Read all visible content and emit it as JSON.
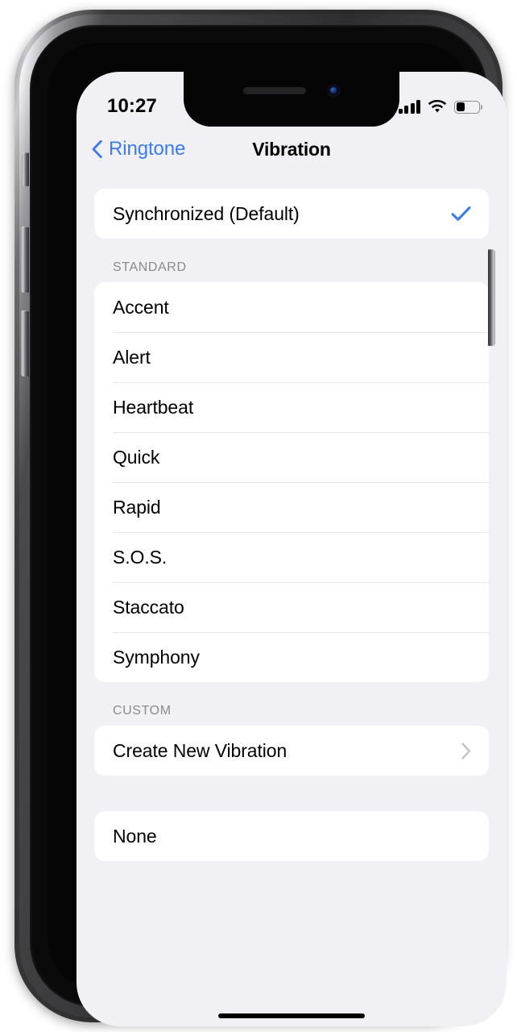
{
  "device": {
    "name": "iphone-x",
    "frame_color": "#2a2a2c"
  },
  "status_bar": {
    "time": "10:27",
    "signal_icon": "cellular-signal-icon",
    "signal_bars_total": 4,
    "signal_bars_active": 4,
    "wifi_icon": "wifi-icon",
    "wifi_strength": "full",
    "battery_icon": "battery-icon",
    "battery_percent": 40
  },
  "nav_bar": {
    "back_icon": "chevron-left-icon",
    "back_label": "Ringtone",
    "title": "Vibration",
    "accent_color": "#3b7ded"
  },
  "sections": [
    {
      "key": "default",
      "header": "",
      "rows": [
        {
          "label": "Synchronized (Default)",
          "accessory": "checkmark",
          "selected": true
        }
      ]
    },
    {
      "key": "standard",
      "header": "STANDARD",
      "rows": [
        {
          "label": "Accent",
          "accessory": "none",
          "selected": false
        },
        {
          "label": "Alert",
          "accessory": "none",
          "selected": false
        },
        {
          "label": "Heartbeat",
          "accessory": "none",
          "selected": false
        },
        {
          "label": "Quick",
          "accessory": "none",
          "selected": false
        },
        {
          "label": "Rapid",
          "accessory": "none",
          "selected": false
        },
        {
          "label": "S.O.S.",
          "accessory": "none",
          "selected": false
        },
        {
          "label": "Staccato",
          "accessory": "none",
          "selected": false
        },
        {
          "label": "Symphony",
          "accessory": "none",
          "selected": false
        }
      ]
    },
    {
      "key": "custom",
      "header": "CUSTOM",
      "rows": [
        {
          "label": "Create New Vibration",
          "accessory": "disclosure",
          "selected": false
        }
      ]
    },
    {
      "key": "none",
      "header": "",
      "rows": [
        {
          "label": "None",
          "accessory": "none",
          "selected": false
        }
      ]
    }
  ],
  "home_indicator": {
    "name": "home-indicator"
  },
  "colors": {
    "screen_background": "#f1f0f5",
    "card_background": "#ffffff",
    "separator": "#e6e6e8",
    "section_header_text": "#8a8a8f",
    "primary_text": "#000000",
    "accent_blue": "#3b7ded",
    "disclosure_gray": "#c4c4c8"
  }
}
